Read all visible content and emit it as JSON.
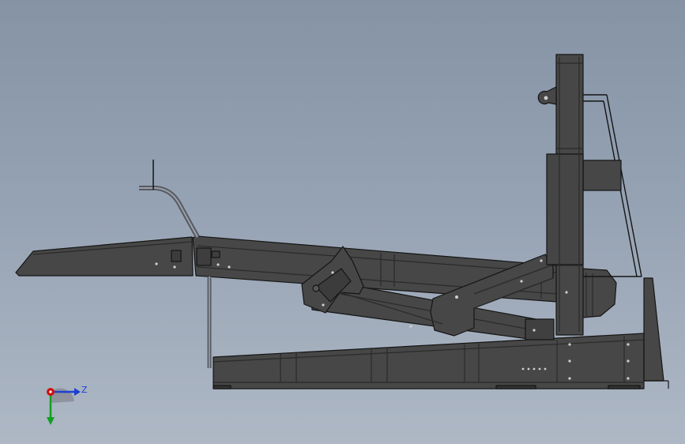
{
  "viewport": {
    "background_top": "#8593a5",
    "background_bottom": "#aeb8c5",
    "model_fill": "#474747",
    "model_edge": "#151515"
  },
  "triad": {
    "z_label": "Z",
    "x_color": "#d01010",
    "y_color": "#10a020",
    "z_color": "#1f3fd0"
  },
  "icons": [
    "coordinate-triad-icon",
    "origin-icon"
  ]
}
